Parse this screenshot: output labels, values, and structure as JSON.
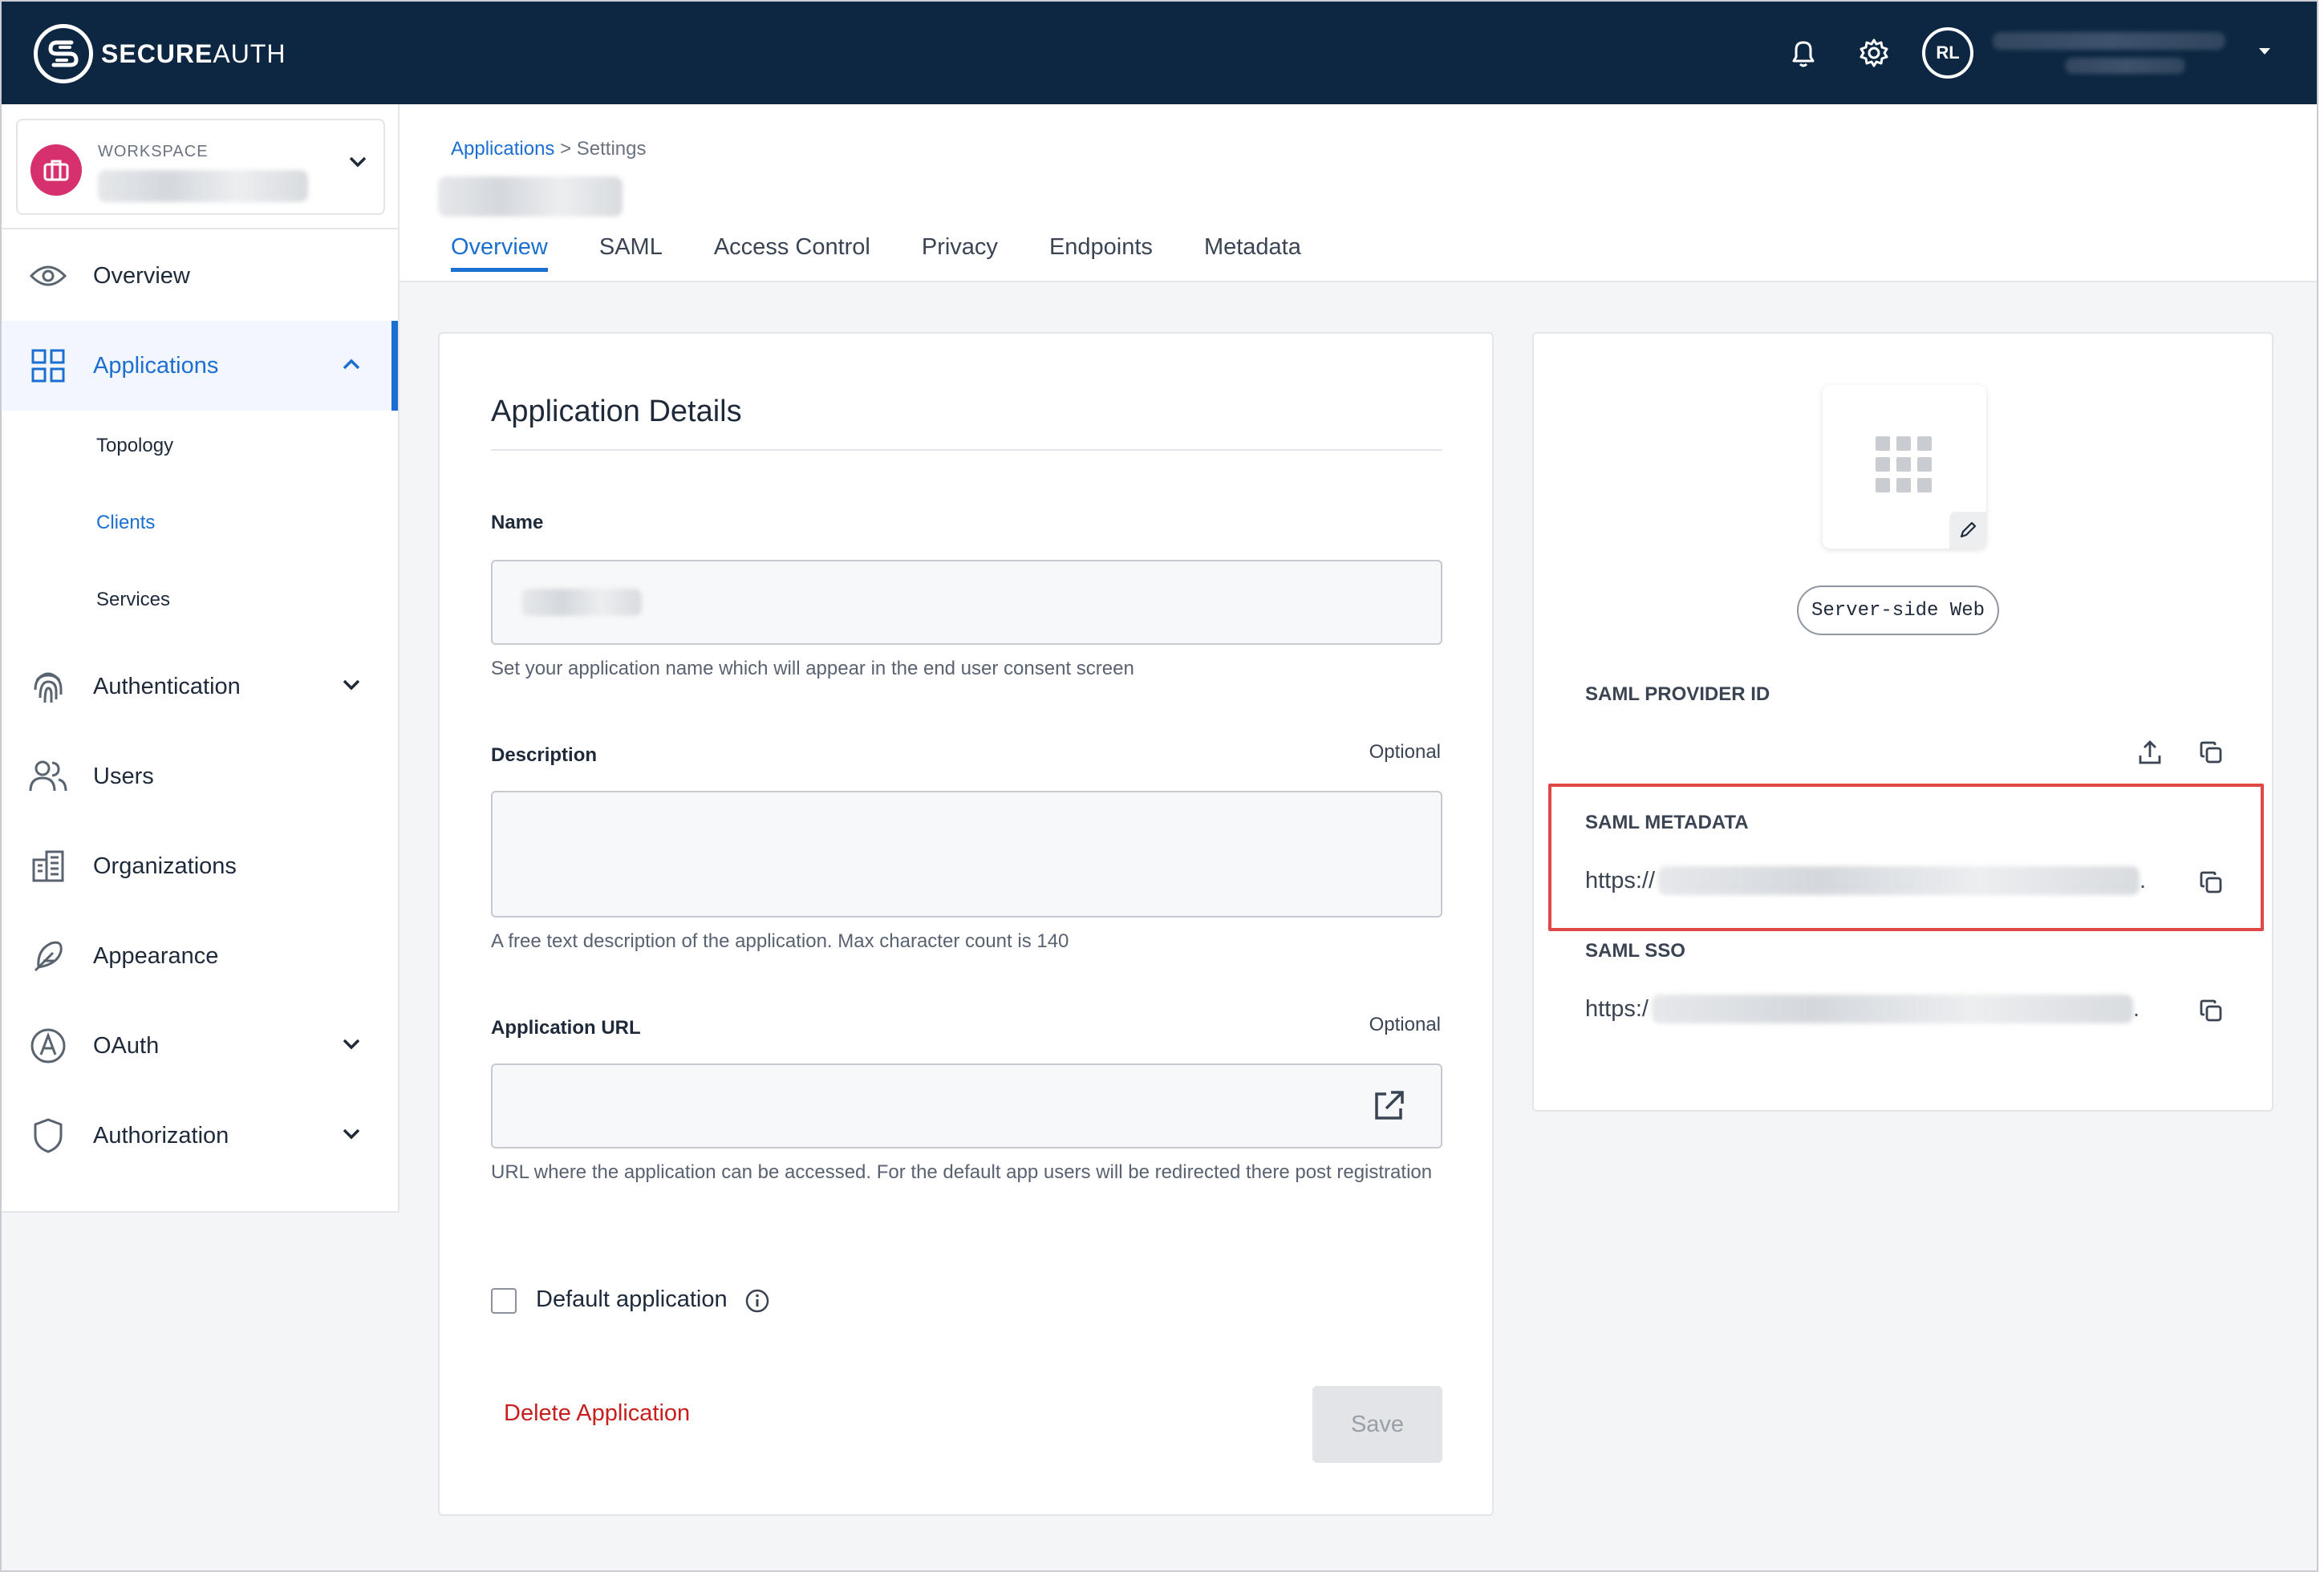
{
  "brand": {
    "logo_bold": "SECURE",
    "logo_light": "AUTH"
  },
  "topbar": {
    "user_initials": "RL"
  },
  "workspace": {
    "label": "WORKSPACE"
  },
  "sidebar": {
    "items": [
      {
        "label": "Overview"
      },
      {
        "label": "Applications"
      },
      {
        "label": "Authentication"
      },
      {
        "label": "Users"
      },
      {
        "label": "Organizations"
      },
      {
        "label": "Appearance"
      },
      {
        "label": "OAuth"
      },
      {
        "label": "Authorization"
      }
    ],
    "sub_items": [
      {
        "label": "Topology"
      },
      {
        "label": "Clients"
      },
      {
        "label": "Services"
      }
    ]
  },
  "breadcrumb": {
    "parent": "Applications",
    "separator": ">",
    "current": "Settings"
  },
  "tabs": [
    "Overview",
    "SAML",
    "Access Control",
    "Privacy",
    "Endpoints",
    "Metadata"
  ],
  "details": {
    "title": "Application Details",
    "name_label": "Name",
    "name_help": "Set your application name which will appear in the end user consent screen",
    "description_label": "Description",
    "description_optional": "Optional",
    "description_help": "A free text description of the application. Max character count is 140",
    "url_label": "Application URL",
    "url_optional": "Optional",
    "url_help": "URL where the application can be accessed. For the default app users will be redirected there post registration",
    "default_app_label": "Default application",
    "delete_label": "Delete Application",
    "save_label": "Save"
  },
  "side": {
    "app_type": "Server-side Web",
    "provider_id_label": "SAML PROVIDER ID",
    "metadata_label": "SAML METADATA",
    "metadata_url_prefix": "https://",
    "metadata_url_suffix": ".",
    "sso_label": "SAML SSO",
    "sso_url_prefix": "https:/",
    "sso_url_suffix": "."
  },
  "colors": {
    "topbar": "#0d2742",
    "accent": "#1b6fd1",
    "danger": "#c81e1e",
    "workspace_icon": "#d6306f",
    "highlight": "#e04848"
  }
}
